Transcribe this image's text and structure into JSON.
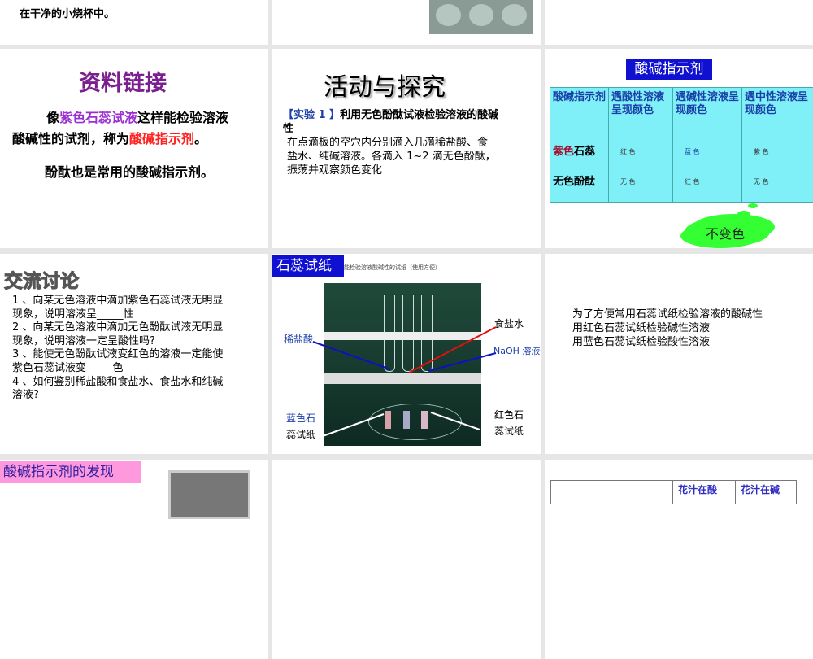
{
  "slides": {
    "s1": {
      "partial_line": "…",
      "text": "在干净的小烧杯中。"
    },
    "s4": {
      "title": "资料链接",
      "line1_pre": "像",
      "line1_hl": "紫色石蕊试液",
      "line1_post": "这样能检验溶液",
      "line2_pre": "酸碱性的试剂，称为",
      "line2_hl": "酸碱指示剂",
      "line2_post": "。",
      "line3": "酚酞也是常用的酸碱指示剂。",
      "colors": {
        "title": "#7a1f8f",
        "purple": "#9b30d0",
        "red": "#ff2020"
      }
    },
    "s5": {
      "title": "活动与探究",
      "exp_label": "【实验 1 】",
      "exp_title": "利用无色酚酞试液检验溶液的酸碱",
      "exp_title2": "性",
      "body": [
        "在点滴板的空穴内分别滴入几滴稀盐酸、食",
        "盐水、纯碱溶液。各滴入 1~2 滴无色酚酞，",
        "振荡并观察颜色变化"
      ]
    },
    "s6": {
      "title": "酸碱指示剂",
      "headers": [
        "酸碱指示剂",
        "遇酸性溶液呈现颜色",
        "遇碱性溶液呈现颜色",
        "遇中性溶液呈现颜色"
      ],
      "rows": [
        {
          "name_a": "紫色",
          "name_b": "石蕊",
          "cells": [
            "红 色",
            "蓝 色",
            "紫 色"
          ]
        },
        {
          "name_a": "",
          "name_b": "无色酚酞",
          "cells": [
            "无 色",
            "红 色",
            "无 色"
          ]
        }
      ],
      "cloud": "不变色"
    },
    "s7": {
      "title": "交流讨论",
      "lines": [
        "1 、向某无色溶液中滴加紫色石蕊试液无明显",
        "现象，说明溶液呈_____性",
        "2 、向某无色溶液中滴加无色酚酞试液无明显",
        "现象，说明溶液一定呈酸性吗?",
        "3 、能使无色酚酞试液变红色的溶液一定能使",
        "紫色石蕊试液变_____色",
        "4 、如何鉴别稀盐酸和食盐水、食盐水和纯碱",
        "溶液?"
      ]
    },
    "s8": {
      "title": "石蕊试纸",
      "subtitle": "能检验溶液酸碱性的试纸（使用方便）",
      "labels": {
        "hcl": "稀盐酸",
        "salt": "食盐水",
        "naoh": "NaOH 溶液",
        "blue1": "蓝色石",
        "blue2": "蕊试纸",
        "red1": "红色石",
        "red2": "蕊试纸"
      }
    },
    "s9": {
      "lines": [
        "为了方便常用石蕊试纸检验溶液的酸碱性",
        "用红色石蕊试纸检验碱性溶液",
        "用蓝色石蕊试纸检验酸性溶液"
      ]
    },
    "s10": {
      "title": "酸碱指示剂的发现"
    },
    "s12": {
      "headers": [
        "",
        "",
        "花汁在酸",
        "花汁在碱"
      ]
    }
  }
}
